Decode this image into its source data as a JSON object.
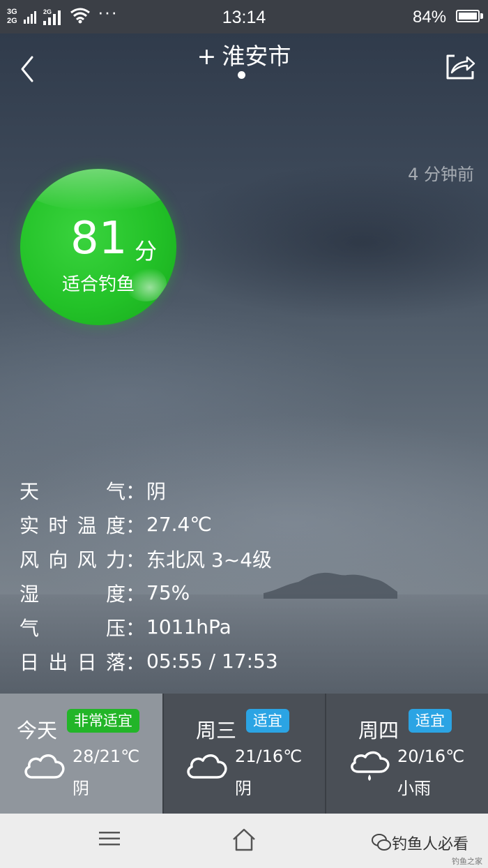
{
  "status_bar": {
    "network_1": "3G",
    "network_2": "2G",
    "network_3": "2G",
    "time": "13:14",
    "battery": "84%"
  },
  "header": {
    "plus": "+",
    "city": "淮安市"
  },
  "updated": "4 分钟前",
  "score": {
    "value": "81",
    "unit": "分",
    "label": "适合钓鱼",
    "color": "#23c228"
  },
  "details": [
    {
      "key": "天气",
      "chars": [
        "天",
        "气"
      ],
      "sep": "：",
      "value": "阴"
    },
    {
      "key": "实时温度",
      "chars": [
        "实",
        "时",
        "温",
        "度"
      ],
      "sep": "：",
      "value": "27.4℃"
    },
    {
      "key": "风向风力",
      "chars": [
        "风",
        "向",
        "风",
        "力"
      ],
      "sep": "：",
      "value": "东北风 3~4级"
    },
    {
      "key": "湿度",
      "chars": [
        "湿",
        "度"
      ],
      "sep": "：",
      "value": "75%"
    },
    {
      "key": "气压",
      "chars": [
        "气",
        "压"
      ],
      "sep": "：",
      "value": "1011hPa"
    },
    {
      "key": "日出日落",
      "chars": [
        "日",
        "出",
        "日",
        "落"
      ],
      "sep": "：",
      "value": "05:55 / 17:53"
    }
  ],
  "forecast": [
    {
      "day": "今天",
      "badge": "非常适宜",
      "badge_color": "#22b528",
      "temp": "28/21℃",
      "desc": "阴",
      "icon": "cloud-icon"
    },
    {
      "day": "周三",
      "badge": "适宜",
      "badge_color": "#2ba4e4",
      "temp": "21/16℃",
      "desc": "阴",
      "icon": "cloud-icon"
    },
    {
      "day": "周四",
      "badge": "适宜",
      "badge_color": "#2ba4e4",
      "temp": "20/16℃",
      "desc": "小雨",
      "icon": "rain-cloud-icon"
    }
  ],
  "watermark": {
    "main": "钓鱼人必看",
    "sub": "钓鱼之家"
  }
}
